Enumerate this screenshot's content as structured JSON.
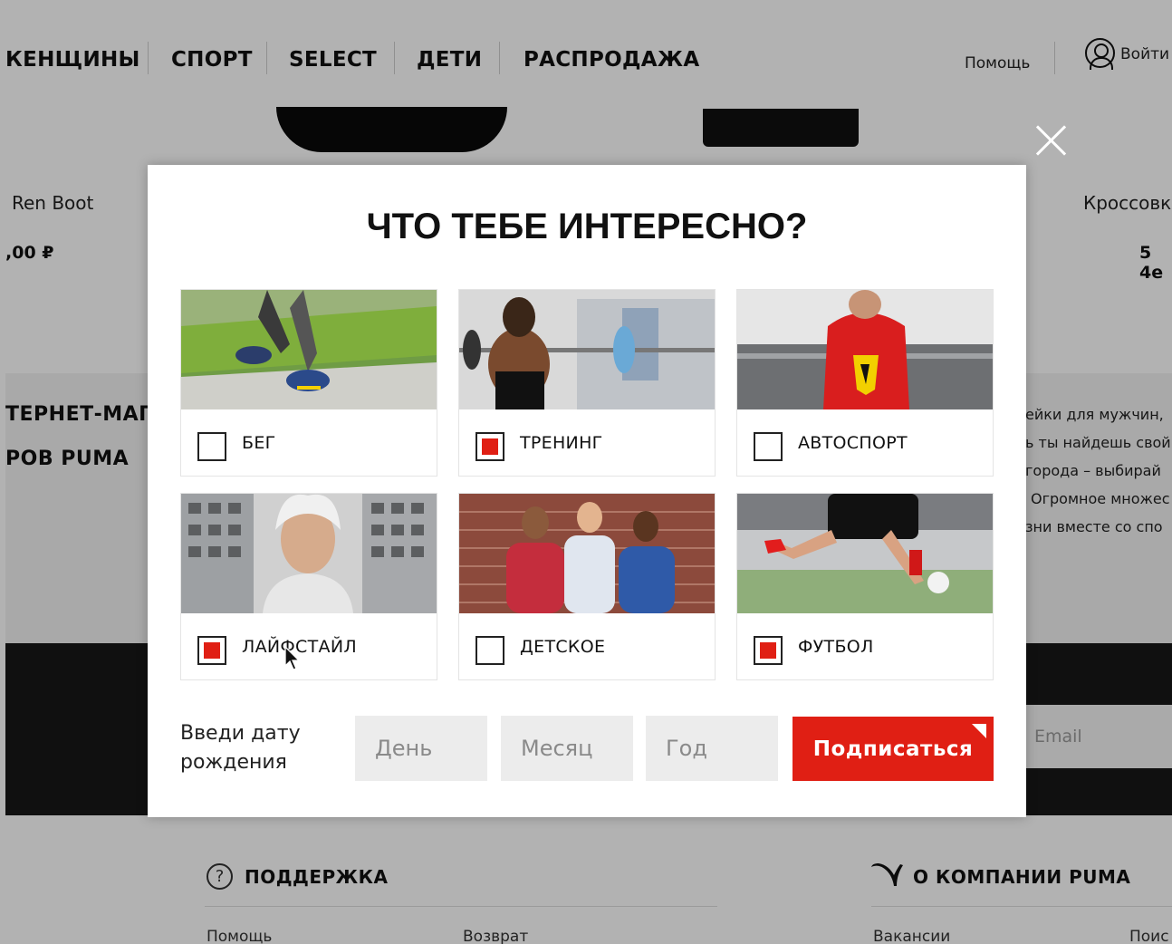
{
  "nav": {
    "items": [
      "КЕНЩИНЫ",
      "СПОРТ",
      "SELECT",
      "ДЕТИ",
      "РАСПРОДАЖА"
    ],
    "help": "Помощь",
    "login": "Войти"
  },
  "products": {
    "left_name": "Ren Boot",
    "left_price": ",00 ₽",
    "right_name": "Кроссовк",
    "right_price": "5 4е"
  },
  "seo": {
    "heading_line1": "ТЕРНЕТ-МАГ",
    "heading_line2": "РОВ PUMA",
    "text_lines": [
      "ейки для мужчин,",
      "ь ты найдешь свой",
      "города – выбирай",
      "Огромное множес",
      "зни вместе со спо"
    ]
  },
  "newsletter": {
    "email_placeholder": "Email"
  },
  "footer": {
    "support_heading": "ПОДДЕРЖКА",
    "help_icon_glyph": "?",
    "about_heading": "О КОМПАНИИ PUMA",
    "links": [
      "Помощь",
      "Возврат",
      "Вакансии",
      "Поис"
    ]
  },
  "modal": {
    "title": "ЧТО ТЕБЕ ИНТЕРЕСНО?",
    "categories": [
      {
        "label": "БЕГ",
        "checked": false,
        "image": "running-photo"
      },
      {
        "label": "ТРЕНИНГ",
        "checked": true,
        "image": "training-photo"
      },
      {
        "label": "АВТОСПОРТ",
        "checked": false,
        "image": "motorsport-photo"
      },
      {
        "label": "ЛАЙФСТАЙЛ",
        "checked": true,
        "image": "lifestyle-photo"
      },
      {
        "label": "ДЕТСКОЕ",
        "checked": false,
        "image": "kids-photo"
      },
      {
        "label": "ФУТБОЛ",
        "checked": true,
        "image": "football-photo"
      }
    ],
    "dob_label_line1": "Введи дату",
    "dob_label_line2": "рождения",
    "day_placeholder": "День",
    "month_placeholder": "Месяц",
    "year_placeholder": "Год",
    "subscribe_label": "Подписаться"
  },
  "colors": {
    "accent_red": "#e01f14",
    "overlay": "rgba(0,0,0,0.30)"
  }
}
